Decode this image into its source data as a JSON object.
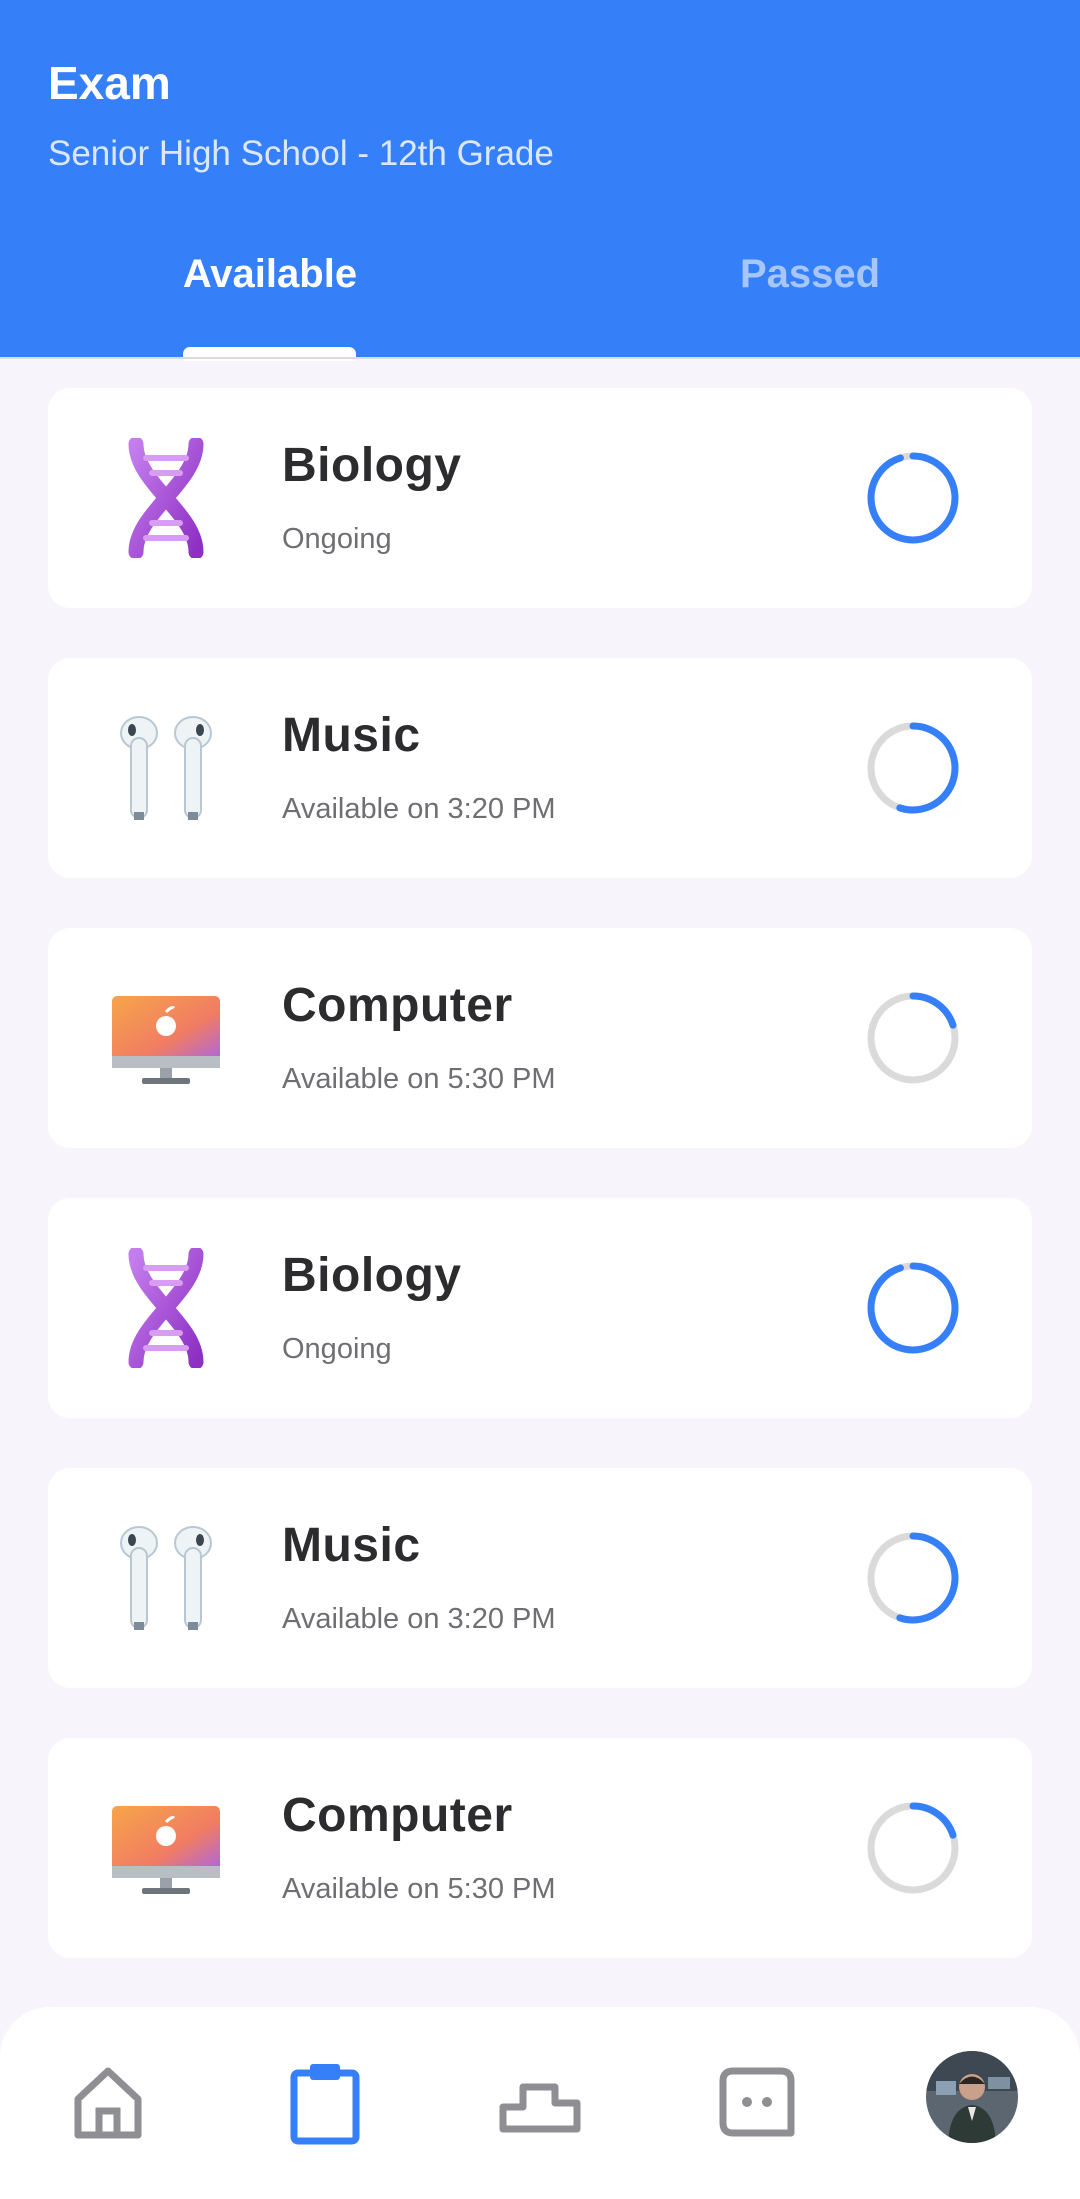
{
  "header": {
    "title": "Exam",
    "subtitle": "Senior High School - 12th Grade",
    "tabs": [
      {
        "label": "Available",
        "active": true
      },
      {
        "label": "Passed",
        "active": false
      }
    ]
  },
  "colors": {
    "primary": "#3580F8",
    "progress_track": "#DADADA",
    "icon_inactive": "#8E8E93",
    "biology": "#A64CD6",
    "music": "#D7E3EA",
    "computer": "#F39A4B"
  },
  "exams": [
    {
      "name": "Biology",
      "status": "Ongoing",
      "icon": "dna-icon",
      "progress": 0.95
    },
    {
      "name": "Music",
      "status": "Available on 3:20 PM",
      "icon": "earbuds-icon",
      "progress": 0.55
    },
    {
      "name": "Computer",
      "status": "Available on 5:30 PM",
      "icon": "computer-icon",
      "progress": 0.2
    },
    {
      "name": "Biology",
      "status": "Ongoing",
      "icon": "dna-icon",
      "progress": 0.95
    },
    {
      "name": "Music",
      "status": "Available on 3:20 PM",
      "icon": "earbuds-icon",
      "progress": 0.55
    },
    {
      "name": "Computer",
      "status": "Available on 5:30 PM",
      "icon": "computer-icon",
      "progress": 0.2
    }
  ],
  "bottom_nav": {
    "items": [
      {
        "icon": "home-icon",
        "active": false
      },
      {
        "icon": "clipboard-icon",
        "active": true
      },
      {
        "icon": "podium-icon",
        "active": false
      },
      {
        "icon": "chat-icon",
        "active": false
      },
      {
        "icon": "avatar",
        "active": false
      }
    ]
  }
}
